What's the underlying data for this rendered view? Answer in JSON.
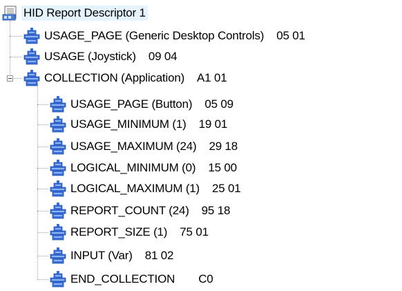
{
  "tree": {
    "root": {
      "label": "HID Report Descriptor 1",
      "icon": "descriptor-document-icon"
    },
    "items": [
      {
        "label": "USAGE_PAGE (Generic Desktop Controls)",
        "code": "05 01",
        "icon": "hid-item-icon"
      },
      {
        "label": "USAGE (Joystick)",
        "code": "09 04",
        "icon": "hid-item-icon"
      },
      {
        "label": "COLLECTION (Application)",
        "code": "A1 01",
        "icon": "hid-item-icon",
        "expanded": true
      },
      {
        "label": "USAGE_PAGE (Button)",
        "code": "05 09",
        "icon": "hid-item-icon"
      },
      {
        "label": "USAGE_MINIMUM (1)",
        "code": "19 01",
        "icon": "hid-item-icon"
      },
      {
        "label": "USAGE_MAXIMUM (24)",
        "code": "29 18",
        "icon": "hid-item-icon"
      },
      {
        "label": "LOGICAL_MINIMUM (0)",
        "code": "15 00",
        "icon": "hid-item-icon"
      },
      {
        "label": "LOGICAL_MAXIMUM (1)",
        "code": "25 01",
        "icon": "hid-item-icon"
      },
      {
        "label": "REPORT_COUNT (24)",
        "code": "95 18",
        "icon": "hid-item-icon"
      },
      {
        "label": "REPORT_SIZE (1)",
        "code": "75 01",
        "icon": "hid-item-icon"
      },
      {
        "label": "INPUT (Var)",
        "code": "81 02",
        "icon": "hid-item-icon"
      },
      {
        "label": "END_COLLECTION",
        "code": "C0",
        "icon": "hid-item-icon"
      }
    ]
  },
  "colors": {
    "selection": "#e5f3ff",
    "icon_blue": "#3a6fd8",
    "icon_blue_light": "#8fb4f2",
    "connector": "#a0a0a0"
  }
}
